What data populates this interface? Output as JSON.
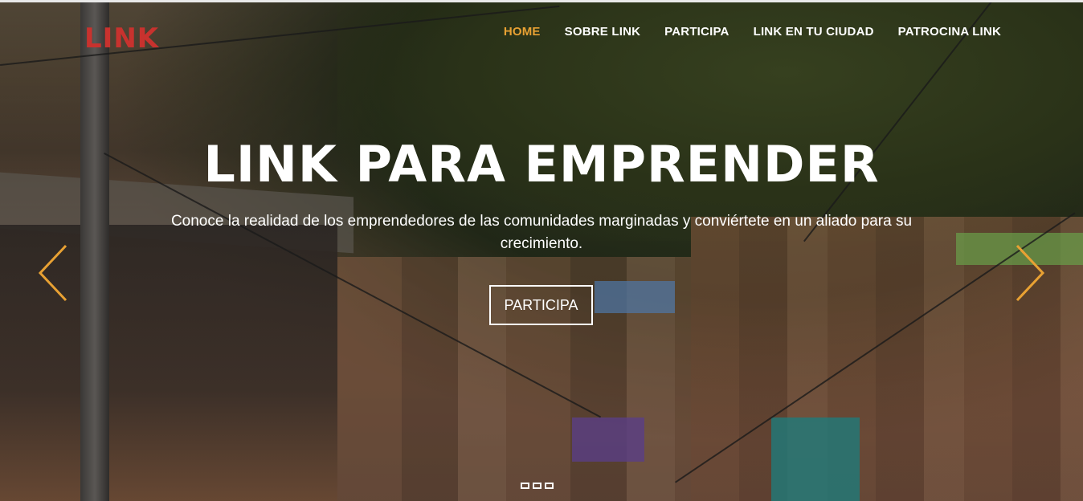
{
  "brand": {
    "logo_text": "LINK"
  },
  "nav": {
    "items": [
      {
        "label": "HOME",
        "active": true
      },
      {
        "label": "SOBRE LINK"
      },
      {
        "label": "PARTICIPA"
      },
      {
        "label": "LINK EN TU CIUDAD"
      },
      {
        "label": "PATROCINA LINK"
      }
    ]
  },
  "hero": {
    "title": "LINK PARA EMPRENDER",
    "subtitle": "Conoce la realidad de los emprendedores de las comunidades marginadas y conviértete en un aliado para su crecimiento.",
    "cta_label": "PARTICIPA"
  },
  "carousel": {
    "prev_icon": "chevron-left-icon",
    "next_icon": "chevron-right-icon",
    "slide_count": 3
  },
  "colors": {
    "accent": "#e8a133",
    "logo_red": "#c8322e",
    "text": "#ffffff"
  }
}
